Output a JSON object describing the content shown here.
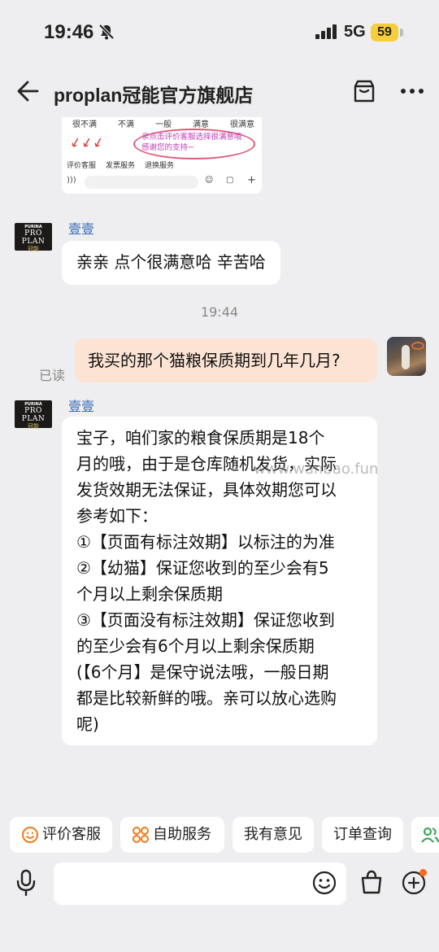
{
  "status_bar": {
    "time": "19:46",
    "network": "5G",
    "battery": "59"
  },
  "nav": {
    "title": "proplan冠能官方旗舰店"
  },
  "preview_card": {
    "ratings": [
      "很不满",
      "不满",
      "一般",
      "满意",
      "很满意"
    ],
    "prompt": "亲点击评价客服选择很满意哦 感谢您的支持~",
    "services": [
      "评价客服",
      "发票服务",
      "退换服务"
    ]
  },
  "shop_avatar": {
    "brand_top": "PURINA",
    "brand": "PRO PLAN",
    "brand_cn": "冠能"
  },
  "messages": [
    {
      "sender": "壹壹",
      "text": "亲亲 点个很满意哈 辛苦哈"
    },
    {
      "timestamp": "19:44"
    },
    {
      "text": "我买的那个猫粮保质期到几年几月?",
      "status": "已读"
    },
    {
      "sender": "壹壹",
      "lines": [
        "宝子，咱们家的粮食保质期是18个",
        "月的哦，由于是仓库随机发货，实际",
        "发货效期无法保证，具体效期您可以",
        "参考如下：",
        "①【页面有标注效期】以标注的为准",
        "②【幼猫】保证您收到的至少会有5",
        "个月以上剩余保质期",
        "③【页面没有标注效期】保证您收到",
        "的至少会有6个月以上剩余保质期",
        "(【6个月】是保守说法哦，一般日期",
        "都是比较新鲜的哦。亲可以放心选购",
        "呢)"
      ]
    }
  ],
  "watermark": "www.wanbao.fun",
  "quick_actions": [
    "评价客服",
    "自助服务",
    "我有意见",
    "订单查询"
  ],
  "colors": {
    "accent": "#ff6a1c",
    "outgoing_bubble": "#fde3d3",
    "sender_name": "#3a6bb5"
  }
}
